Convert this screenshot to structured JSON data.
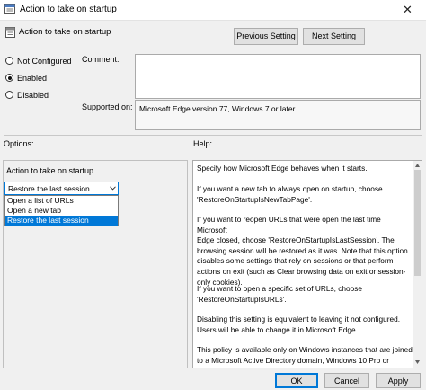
{
  "window": {
    "title": "Action to take on startup",
    "close_glyph": "✕"
  },
  "header": {
    "title": "Action to take on startup"
  },
  "nav": {
    "previous": "Previous Setting",
    "next": "Next Setting"
  },
  "state": {
    "options": [
      {
        "label": "Not Configured",
        "selected": false
      },
      {
        "label": "Enabled",
        "selected": true
      },
      {
        "label": "Disabled",
        "selected": false
      }
    ]
  },
  "comment": {
    "label": "Comment:",
    "value": ""
  },
  "supported": {
    "label": "Supported on:",
    "value": "Microsoft Edge version 77, Windows 7 or later"
  },
  "options_section": {
    "label": "Options:",
    "field_label": "Action to take on startup",
    "selected_value": "Restore the last session",
    "choices": [
      "Open a list of URLs",
      "Open a new tab",
      "Restore the last session"
    ]
  },
  "help": {
    "label": "Help:",
    "paragraphs": [
      [
        "Specify how Microsoft Edge behaves when it starts."
      ],
      [
        "If you want a new tab to always open on startup, choose",
        "'RestoreOnStartupIsNewTabPage'."
      ],
      [
        "If you want to reopen URLs that were open the last time Microsoft",
        "Edge closed, choose 'RestoreOnStartupIsLastSession'. The",
        "browsing session will be restored as it was. Note that this option",
        "disables some settings that rely on sessions or that perform",
        "actions on exit (such as Clear browsing data on exit or session-",
        "only cookies)."
      ],
      [
        "If you want to open a specific set of URLs, choose",
        "'RestoreOnStartupIsURLs'."
      ],
      [
        "Disabling this setting is equivalent to leaving it not configured.",
        "Users will be able to change it in Microsoft Edge."
      ],
      [
        "This policy is available only on Windows instances that are joined",
        "to a Microsoft Active Directory domain, Windows 10 Pro or"
      ]
    ]
  },
  "footer": {
    "ok": "OK",
    "cancel": "Cancel",
    "apply": "Apply"
  },
  "colors": {
    "accent": "#0078d7"
  },
  "icons": {
    "app": "policy-icon",
    "header": "policy-icon",
    "dropdown": "chevron-down-icon"
  }
}
